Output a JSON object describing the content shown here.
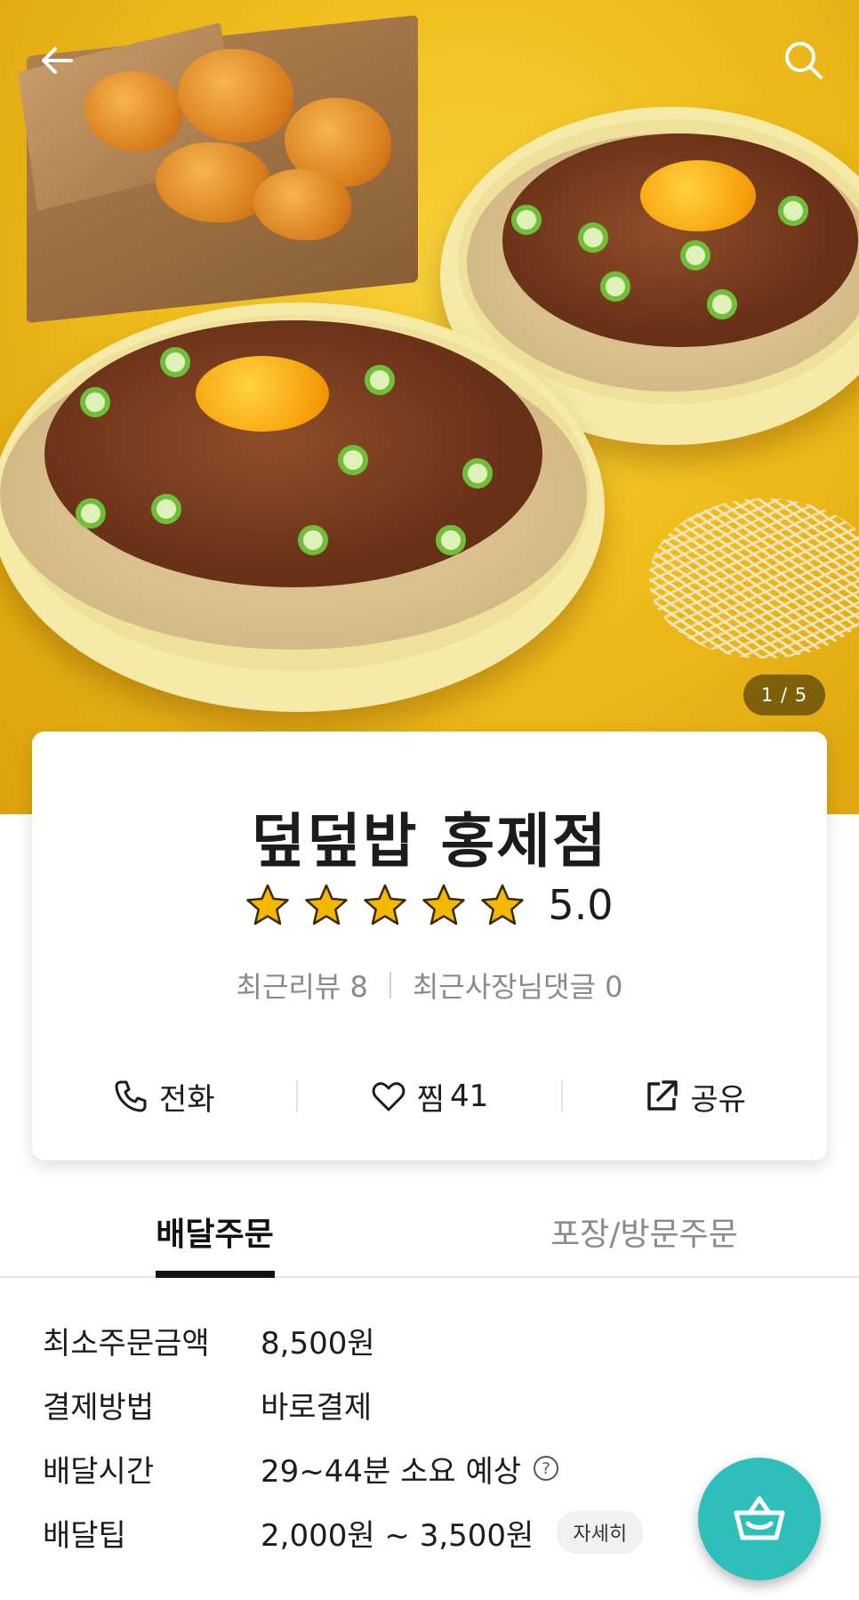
{
  "hero": {
    "page_counter": "1 / 5",
    "back_icon": "arrow-left-icon",
    "search_icon": "search-icon"
  },
  "store": {
    "name": "덮덮밥 홍제점",
    "rating": "5.0",
    "stars": 5,
    "recent_reviews": "최근리뷰 8",
    "owner_replies": "최근사장님댓글 0"
  },
  "actions": {
    "call_label": "전화",
    "like_label": "찜",
    "like_count": "41",
    "share_label": "공유"
  },
  "tabs": [
    {
      "label": "배달주문",
      "active": true
    },
    {
      "label": "포장/방문주문",
      "active": false
    }
  ],
  "info": {
    "min_order_label": "최소주문금액",
    "min_order_value": "8,500원",
    "payment_label": "결제방법",
    "payment_value": "바로결제",
    "delivery_time_label": "배달시간",
    "delivery_time_value": "29~44분 소요 예상",
    "delivery_tip_label": "배달팁",
    "delivery_tip_value": "2,000원 ~ 3,500원",
    "detail_chip": "자세히"
  },
  "colors": {
    "accent": "#2ebfbb",
    "star": "#f5b800",
    "hero_background": "#efbd1c"
  }
}
